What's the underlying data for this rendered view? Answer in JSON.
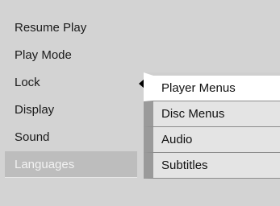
{
  "main_menu": {
    "items": [
      {
        "label": "Resume Play"
      },
      {
        "label": "Play Mode"
      },
      {
        "label": "Lock"
      },
      {
        "label": "Display"
      },
      {
        "label": "Sound"
      },
      {
        "label": "Languages",
        "selected": true
      }
    ]
  },
  "submenu": {
    "items": [
      {
        "label": "Player Menus",
        "active": true
      },
      {
        "label": "Disc Menus"
      },
      {
        "label": "Audio"
      },
      {
        "label": "Subtitles"
      }
    ]
  },
  "icons": {
    "submenu_indicator": "left-arrow-icon"
  },
  "colors": {
    "background": "#d3d3d3",
    "selected_bg": "#bdbdbd",
    "submenu_bg": "#e4e4e4",
    "submenu_active_bg": "#ffffff",
    "submenu_stripe": "#9a9a9a"
  }
}
